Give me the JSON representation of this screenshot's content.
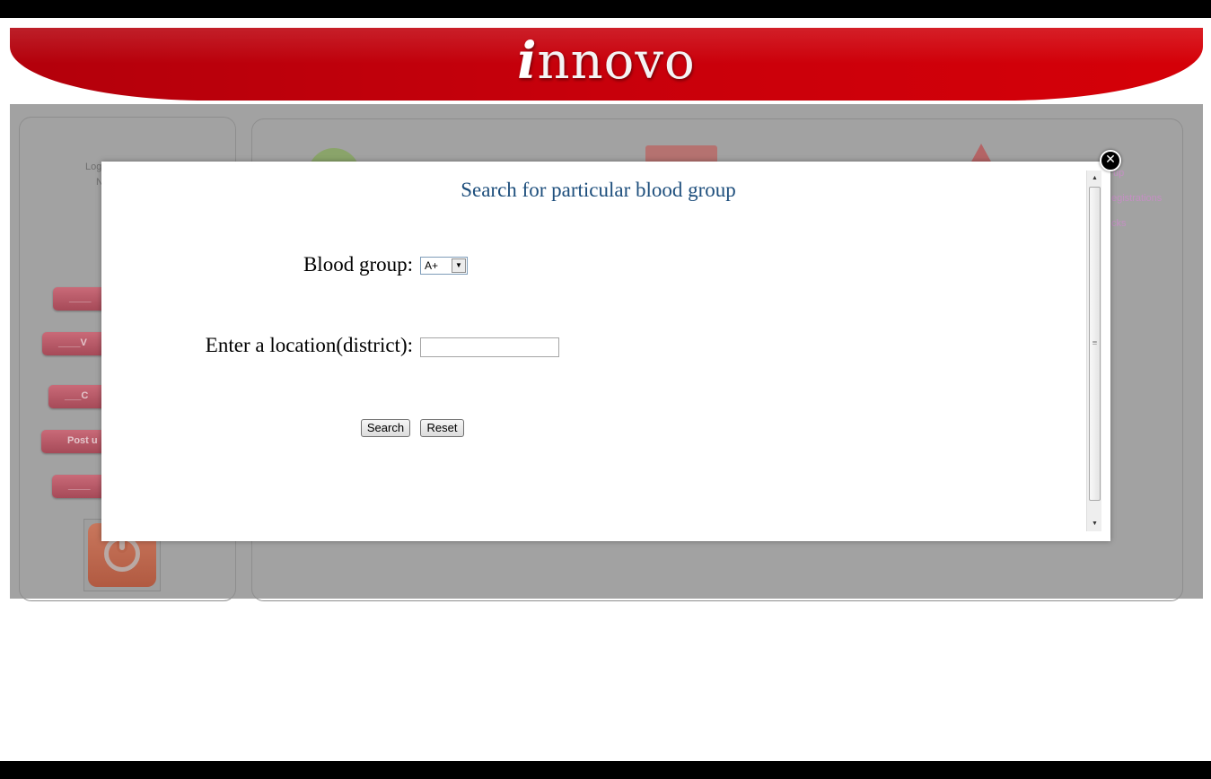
{
  "header": {
    "logo_mark": "i",
    "logo_text": "nnovo"
  },
  "background": {
    "left_panel": {
      "login_label": "Log",
      "sub_label": "N",
      "buttons": [
        "____",
        "____V",
        "___C",
        "Post u",
        "____"
      ]
    },
    "links": [
      "up",
      "egistrations",
      "cks"
    ]
  },
  "modal": {
    "title": "Search for particular blood group",
    "blood_group_label": "Blood group:",
    "blood_group_value": "A+",
    "location_label": "Enter a location(district):",
    "location_value": "",
    "search_label": "Search",
    "reset_label": "Reset",
    "close_icon": "close-icon"
  },
  "colors": {
    "banner": "#c8000b",
    "title": "#1d4e7c",
    "overlay": "#a2a2a2"
  }
}
